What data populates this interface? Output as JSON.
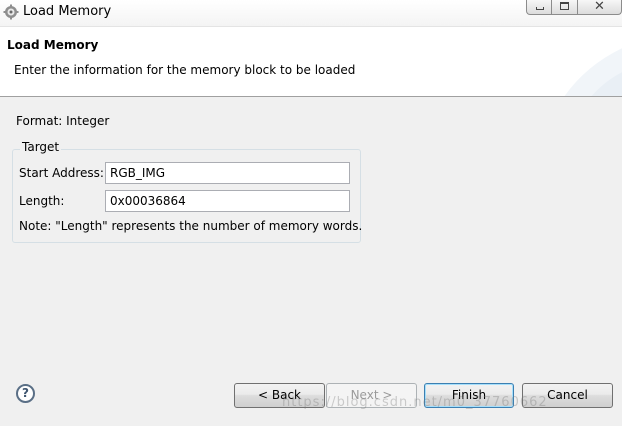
{
  "window": {
    "title": "Load Memory",
    "icon": "eclipse-gear-icon",
    "controls": {
      "minimize": "minimize-icon",
      "maximize": "maximize-icon",
      "close": "close-icon"
    }
  },
  "header": {
    "title": "Load Memory",
    "description": "Enter the information for the memory block to be loaded"
  },
  "form": {
    "format_label": "Format: Integer",
    "group_title": "Target",
    "start_address_label": "Start Address:",
    "start_address_value": "RGB_IMG",
    "length_label": "Length:",
    "length_value": "0x00036864",
    "note": "Note: \"Length\" represents the number of memory words."
  },
  "buttons": {
    "back": "< Back",
    "next": "Next >",
    "finish": "Finish",
    "cancel": "Cancel"
  },
  "help": {
    "glyph": "?",
    "icon": "help-icon"
  },
  "watermark": "https://blog.csdn.net/m0_37760662"
}
